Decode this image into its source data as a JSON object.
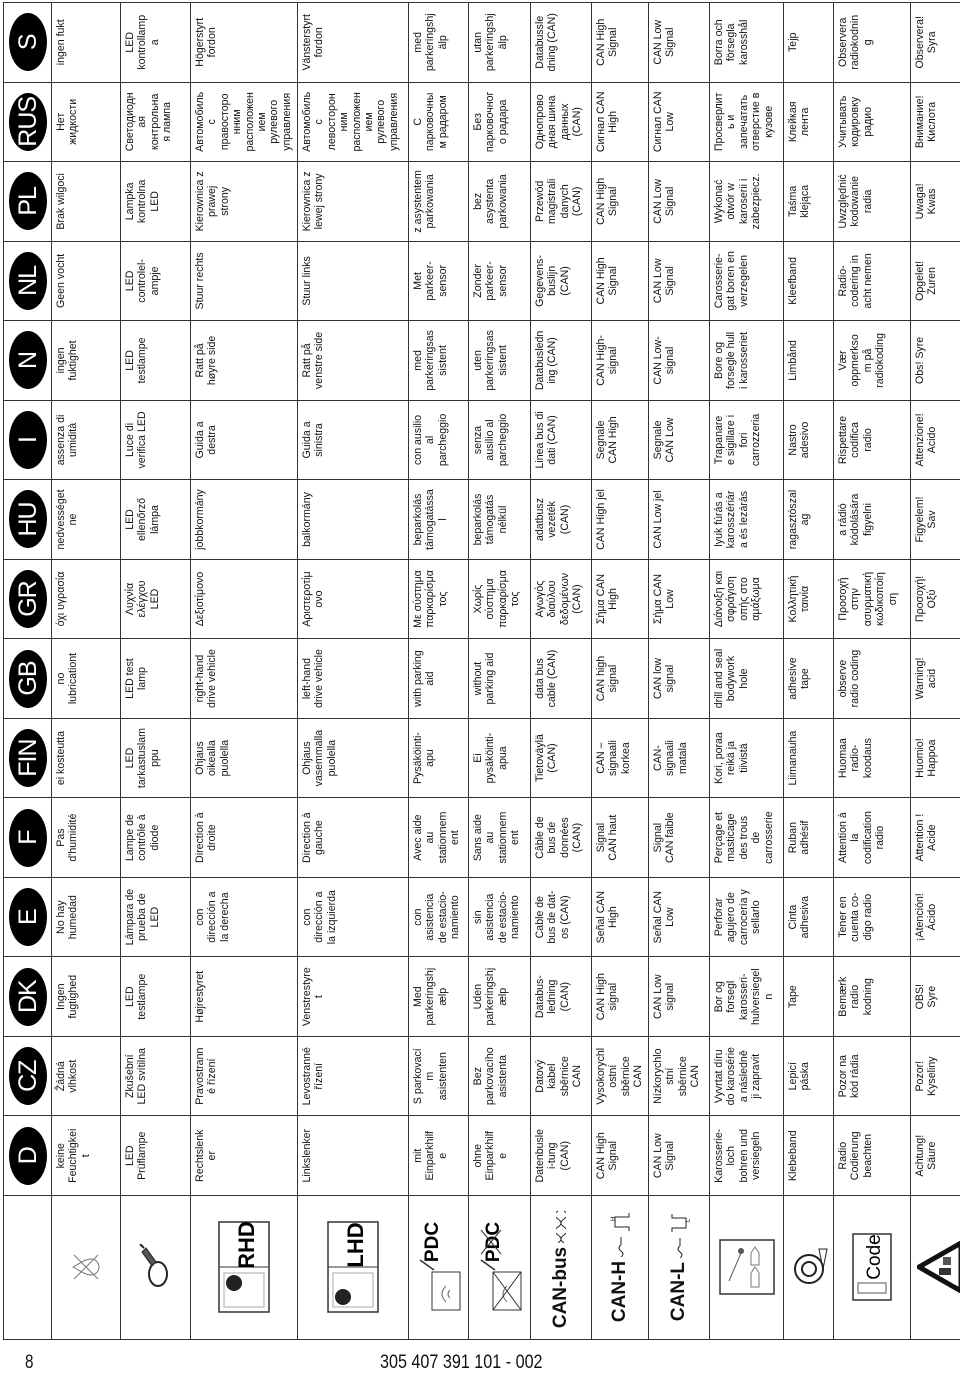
{
  "icons": [
    {
      "name": "no-moisture-icon"
    },
    {
      "name": "led-test-lamp-icon"
    },
    {
      "name": "rhd-icon",
      "label": "RHD"
    },
    {
      "name": "lhd-icon",
      "label": "LHD"
    },
    {
      "name": "pdc-icon",
      "label": "PDC"
    },
    {
      "name": "no-pdc-icon",
      "label": "PDC"
    },
    {
      "name": "can-bus-icon",
      "label": "CAN-bus"
    },
    {
      "name": "can-high-icon",
      "label": "CAN-H"
    },
    {
      "name": "can-low-icon",
      "label": "CAN-L"
    },
    {
      "name": "drill-seal-icon"
    },
    {
      "name": "adhesive-tape-icon"
    },
    {
      "name": "radio-code-icon",
      "label": "Code"
    },
    {
      "name": "acid-warning-icon"
    }
  ],
  "languages": [
    {
      "code": "D",
      "cells": [
        "keine\nFeuchtigkei\nt",
        "LED\nPrüflampe",
        "Rechtslenk\ner",
        "Linkslenker",
        "mit\nEinparkhilf\ne",
        "ohne\nEinparkhilf\ne",
        "Datenbusle\ni-tung\n(CAN)",
        "CAN High\nSignal",
        "CAN Low\nSignal",
        "Karosserie-\nloch\nbohren und\nversiegeln",
        "Klebeband",
        "Radio\nCodierung\nbeachten",
        "Achtung!\nSäure"
      ]
    },
    {
      "code": "CZ",
      "cells": [
        "Žádná\nvlhkost",
        "Zkušební\nLED svítilna",
        "Pravostrann\né řízení",
        "Levostranné\nřízení",
        "S parkovací\nm\nasistenten",
        "Bez\nparkovacího\nasistenta",
        "Datový\nkabel\nsběrnice\nCAN",
        "Vysokorychl\nostní\nsběrnice\nCAN",
        "Nízkorychlo\nstní\nsběrnice\nCAN",
        "Vyvrtat díru\ndo karosérie\na následně\nji zapravit",
        "Lepicí\npáska",
        "Pozor na\nkód rádia",
        "Pozor!\nKyseliny"
      ]
    },
    {
      "code": "DK",
      "cells": [
        "Ingen\nfugtighed",
        "LED\ntestlampe",
        "Højrestyret",
        "Venstrestyre\nt",
        "Med\nparkeringshj\nælp",
        "Uden\nparkeringshj\nælp",
        "Databus-\nledning\n(CAN)",
        "CAN High\nsignal",
        "CAN Low\nsignal",
        "Bor og\nforsegl\nkarosseri-\nhulversiegel\nn",
        "Tape",
        "Bemærk\nradio\nkodning",
        "OBS!\nSyre"
      ]
    },
    {
      "code": "E",
      "cells": [
        "No hay\nhumedad",
        "Lámpara de\nprueba de\nLED",
        "con\ndirección a\nla derecha",
        "con\ndirección a\nla izquierda",
        "con\nasistencia\nde estacio-\nnamiento",
        "sin\nasistencia\nde estacio-\nnamiento",
        "Cable de\nbus de dat-\nos (CAN)",
        "Señal CAN\nHigh",
        "Señal CAN\nLow",
        "Perforar\nagujero de\ncarrocería y\nsellarlo",
        "Cinta\nadhesiva",
        "Tener en\ncuenta co-\ndigo radio",
        "¡Atención!\nÁcido"
      ]
    },
    {
      "code": "F",
      "cells": [
        "Pas\nd'humidité",
        "Lampe de\ncontrôle à\ndiode",
        "Direction à\ndroite",
        "Direction à\ngauche",
        "Avec aide\nau\nstationnem\nent",
        "Sans aide\nau\nstationnem\nent",
        "Câble de\nbus de\ndonnées\n(CAN)",
        "Signal\nCAN haut",
        "Signal\nCAN faible",
        "Perçage et\nmasticage\ndes trous\nde\ncarrosserie",
        "Ruban\nadhésif",
        "Attention à\nla\ncodification\nradio",
        "Attention !\nAcide"
      ]
    },
    {
      "code": "FIN",
      "cells": [
        "ei kosteutta",
        "LED\ntarkastuslam\nppu",
        "Ohjaus\noikealla\npuolella",
        "Ohjaus\nvasemmalla\npuolella",
        "Pysäköinti-\napu",
        "Ei\npysäköinti-\napua",
        "Tietoväylä\n(CAN)",
        "CAN –\nsignaali\nkorkea",
        "CAN-\nsignaali\nmatala",
        "Kori, poraa\nreikä ja\ntiivistä",
        "Liimanauha",
        "Huomaa\nradio-\nkoodaus",
        "Huomio!\nHappoa"
      ]
    },
    {
      "code": "GB",
      "cells": [
        "no\nlubricationt",
        "LED test\nlamp",
        "right-hand\ndrive vehicle",
        "left-hand\ndrive vehicle",
        "with parking\naid",
        "without\nparking aid",
        "data bus\ncable (CAN)",
        "CAN high\nsignal",
        "CAN low\nsignal",
        "drill and seal\nbodywork\nhole",
        "adhesive\ntape",
        "observe\nradio coding",
        "Warning!\nacid"
      ]
    },
    {
      "code": "GR",
      "cells": [
        "όχι υγρασία",
        "Λυχνία\nελέγχου\nLED",
        "Δεξιοτίμονο",
        "Αριστεροτίμ\nονο",
        "Με σύστημα\nπαρκαρίσμα\nτος",
        "Χωρίς\nσύστημα\nπαρκαρίσμα\nτος",
        "Αγωγός\nδιαύλου\nδεδομένων\n(CAN)",
        "Σήμα CAN\nHigh",
        "Σήμα CAN\nLow",
        "Διάνοιξη και\nσφράγιση\nοπής στο\nαμάξωμα",
        "Κολλητική\nταινία",
        "Προσοχή\nστην\nασυρματική\nκωδικοποίη\nση",
        "Προσοχή!\nΟξύ"
      ]
    },
    {
      "code": "HU",
      "cells": [
        "nedvességet\nne",
        "LED\nellenőrző\nlámpa",
        "jobbkormány",
        "balkormány",
        "beparkolás\ntámogatássa\nl",
        "beparkolás\ntámogatás\nnélkül",
        "adatbusz\nvezeték\n(CAN)",
        "CAN High jel",
        "CAN Low jel",
        "lyuk fúrás a\nkarosszériár\na és lezárás",
        "ragasztószal\nag",
        "a rádió\nkódolására\nfigyelni",
        "Figyelem!\nSav"
      ]
    },
    {
      "code": "I",
      "cells": [
        "assenza di\numidità",
        "Luce di\nverifica LED",
        "Guida a\ndestra",
        "Guida a\nsinistra",
        "con ausilio\nal\nparcheggio",
        "senza\nausilio al\nparcheggio",
        "Linea bus di\ndati (CAN)",
        "Segnale\nCAN High",
        "Segnale\nCAN Low",
        "Trapanare\ne sigillare i\nfori\ncarrozzeria",
        "Nastro\nadesivo",
        "Rispettare\ncodifica\nradio",
        "Attenzione!\nAcido"
      ]
    },
    {
      "code": "N",
      "cells": [
        "ingen\nfuktighet",
        "LED\ntestlampe",
        "Ratt på\nhøyre side",
        "Ratt på\nvenstre side",
        "med\nparkeringsas\nsistent",
        "uten\nparkeringsas\nsistent",
        "Databusledn\ning (CAN)",
        "CAN High-\nsignal",
        "CAN Low-\nsignal",
        "Bore og\nforsegle hull\ni karosseriet",
        "Limbånd",
        "Vær\noppmerkso\nm på\nradiokoding",
        "Obs! Syre"
      ]
    },
    {
      "code": "NL",
      "cells": [
        "Geen vocht",
        "LED\ncontrolel-\nampje",
        "Stuur rechts",
        "Stuur links",
        "Met\nparkeer-\nsensor",
        "Zonder\nparkeer-\nsensor",
        "Gegevens-\nbuslijn\n(CAN)",
        "CAN High\nSignal",
        "CAN Low\nSignal",
        "Carosserie-\ngat boren en\nverzegelen",
        "Kleefband",
        "Radio-\ncodering in\nacht nemen",
        "Opgelet!\nZuren"
      ]
    },
    {
      "code": "PL",
      "cells": [
        "Brak wilgoci",
        "Lampka\nkontrolna\nLED",
        "Kierownica z\nprawej\nstrony",
        "Kierownica z\nlewej strony",
        "z asystentem\nparkowania",
        "bez\nasystenta\nparkowania",
        "Przewód\nmagistrali\ndanych\n(CAN)",
        "CAN High\nSignal",
        "CAN Low\nSignal",
        "Wykonać\notwór w\nkaroserii i\nzabezpiecz.",
        "Taśma\nklejąca",
        "Uwzględnić\nkodowanie\nradia",
        "Uwaga!\nKwas"
      ]
    },
    {
      "code": "RUS",
      "cells": [
        "Нет\nжидкости",
        "Светодиодн\nая\nконтрольна\nя лампа",
        "Автомобиль\nс\nправосторо\nнним\nрасположен\nием\nрулевого\nуправления",
        "Автомобиль\nс\nлевосторон\nним\nрасположен\nием\nрулевого\nуправления",
        "С\nпарковочны\nм радаром",
        "Без\nпарковочног\nо радара",
        "Однопрово\nдная шина\nданных\n(CAN)",
        "Сигнал CAN\nHigh",
        "Сигнал CAN\nLow",
        "Просверлит\nь и\nзапечатать\nотверстие в\nкузове",
        "Клейкая\nлента",
        "Учитывать\nкодировку\nрадио",
        "Внимание!\nКислота"
      ]
    },
    {
      "code": "S",
      "cells": [
        "ingen fukt",
        "LED\nkontrollamp\na",
        "Högerstyrt\nfordon",
        "Vänsterstyrt\nfordon",
        "med\nparkeringshj\nälp",
        "utan\nparkeringshj\nälp",
        "Databussle\ndning (CAN)",
        "CAN High\nSignal",
        "CAN Low\nSignal",
        "Borra och\nförsegla\nkarosshål",
        "Tejp",
        "Observera\nradiokodnin\ng",
        "Observera!\nSyra"
      ]
    }
  ],
  "footer": {
    "page_number": "8",
    "document_number": "305 407 391 101 - 002"
  }
}
